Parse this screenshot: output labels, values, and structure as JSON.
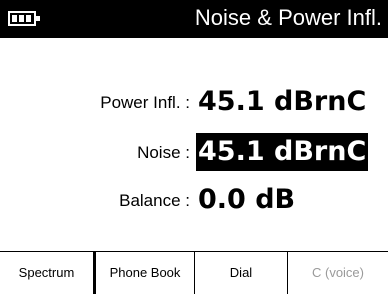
{
  "header": {
    "title": "Noise & Power Infl.",
    "battery_icon": "battery-icon"
  },
  "readings": {
    "power_infl": {
      "label": "Power Infl. :",
      "value": "45.1 dBrnC"
    },
    "noise": {
      "label": "Noise :",
      "value": "45.1 dBrnC",
      "selected": true
    },
    "balance": {
      "label": "Balance :",
      "value": "0.0 dB"
    }
  },
  "softkeys": [
    {
      "label": "Spectrum",
      "enabled": true
    },
    {
      "label": "Phone Book",
      "enabled": true
    },
    {
      "label": "Dial",
      "enabled": true
    },
    {
      "label": "C (voice)",
      "enabled": false
    }
  ],
  "colors": {
    "background": "#ffffff",
    "foreground": "#000000",
    "disabled": "#9a9a9a"
  }
}
